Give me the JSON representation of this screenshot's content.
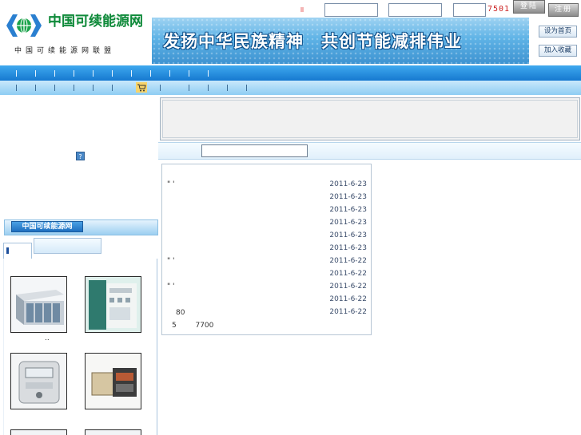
{
  "header": {
    "logo_title": "中国可续能源网",
    "logo_subtitle": "中国可续能源网联盟",
    "slogan": "发扬中华民族精神　共创节能减排伟业",
    "captcha": "7501",
    "login_label": "登陆",
    "register_label": "注册",
    "set_home_label": "设为首页",
    "favorite_label": "加入收藏"
  },
  "left": {
    "help_label": "?",
    "section_title": "中国可续能源网",
    "products": [
      {
        "caption": ".."
      },
      {
        "caption": ""
      },
      {
        "caption": ""
      },
      {
        "caption": ""
      }
    ]
  },
  "news": {
    "items": [
      {
        "title": "\"  '",
        "date": "2011-6-23"
      },
      {
        "title": "",
        "date": "2011-6-23"
      },
      {
        "title": "",
        "date": "2011-6-23"
      },
      {
        "title": "",
        "date": "2011-6-23"
      },
      {
        "title": "",
        "date": "2011-6-23"
      },
      {
        "title": "",
        "date": "2011-6-23"
      },
      {
        "title": "     \"  '",
        "date": "2011-6-22"
      },
      {
        "title": "",
        "date": "2011-6-22"
      },
      {
        "title": "    \" '",
        "date": "2011-6-22"
      },
      {
        "title": "",
        "date": "2011-6-22"
      },
      {
        "title": "",
        "date": "2011-6-22"
      }
    ],
    "footer_count": "80",
    "footer_left": "5",
    "footer_total": "7700"
  },
  "colors": {
    "brand_green": "#0f8a3a",
    "nav_blue": "#1679d0",
    "captcha_red": "#cc2222"
  }
}
